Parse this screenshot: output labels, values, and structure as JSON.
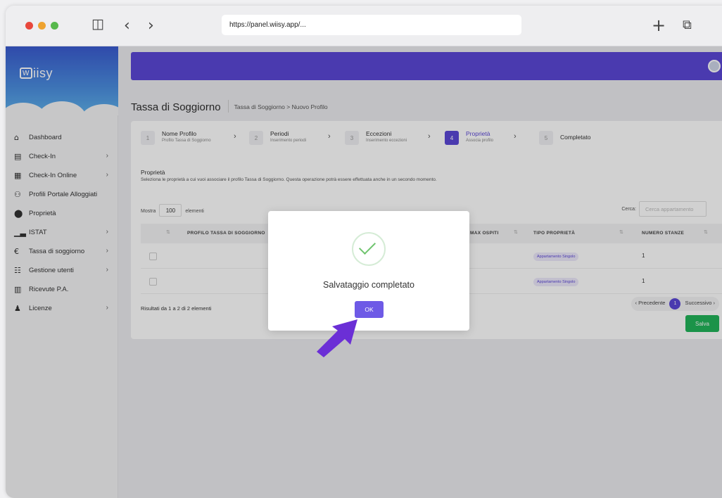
{
  "browser": {
    "url": "https://panel.wiisy.app/...",
    "traffic_light_colors": [
      "#e8473c",
      "#eea330",
      "#57b84c"
    ]
  },
  "sidebar": {
    "logo_text": "iisy",
    "items": [
      {
        "label": "Dashboard",
        "icon": "home-icon",
        "has_chevron": false
      },
      {
        "label": "Check-In",
        "icon": "document-icon",
        "has_chevron": true
      },
      {
        "label": "Check-In Online",
        "icon": "calendar-icon",
        "has_chevron": true
      },
      {
        "label": "Profili Portale Alloggiati",
        "icon": "users-icon",
        "has_chevron": false
      },
      {
        "label": "Proprietà",
        "icon": "location-pin-icon",
        "has_chevron": false
      },
      {
        "label": "ISTAT",
        "icon": "chart-icon",
        "has_chevron": true
      },
      {
        "label": "Tassa di soggiorno",
        "icon": "euro-icon",
        "has_chevron": true
      },
      {
        "label": "Gestione utenti",
        "icon": "group-icon",
        "has_chevron": true
      },
      {
        "label": "Ricevute P.A.",
        "icon": "receipt-icon",
        "has_chevron": false
      },
      {
        "label": "Licenze",
        "icon": "license-icon",
        "has_chevron": true
      }
    ]
  },
  "header": {
    "title": "Tassa di Soggiorno",
    "breadcrumb": "Tassa di Soggiorno  >  Nuovo Profilo",
    "accent_color": "#5b47d6"
  },
  "steps": [
    {
      "num": "1",
      "title": "Nome Profilo",
      "subtitle": "Profilo Tassa di Soggiorno",
      "active": false
    },
    {
      "num": "2",
      "title": "Periodi",
      "subtitle": "Inserimento periodi",
      "active": false
    },
    {
      "num": "3",
      "title": "Eccezioni",
      "subtitle": "Inserimento eccezioni",
      "active": false
    },
    {
      "num": "4",
      "title": "Proprietà",
      "subtitle": "Associa profilo",
      "active": true
    },
    {
      "num": "5",
      "title": "Completato",
      "subtitle": "",
      "active": false
    }
  ],
  "section": {
    "title": "Proprietà",
    "description": "Seleziona le proprietà a cui vuoi associare il profilo Tassa di Soggiorno. Questa operazione potrà essere effettuata anche in un secondo momento."
  },
  "table_controls": {
    "show_label": "Mostra",
    "page_size": "100",
    "elements_label": "elementi",
    "search_label": "Cerca:",
    "search_placeholder": "Cerca appartamento"
  },
  "table": {
    "columns": [
      "PROFILO TASSA DI SOGGIORNO",
      "MAX OSPITI",
      "TIPO PROPRIETÀ",
      "NUMERO STANZE"
    ],
    "rows": [
      {
        "tipo": "Appartamento Singolo",
        "stanze": "1"
      },
      {
        "tipo": "Appartamento Singolo",
        "stanze": "1"
      }
    ]
  },
  "footer": {
    "results": "Risultati da 1 a 2 di 2 elementi",
    "prev": "‹ Precedente",
    "page": "1",
    "next": "Successivo ›",
    "save": "Salva"
  },
  "modal": {
    "title": "Salvataggio completato",
    "ok": "OK"
  }
}
